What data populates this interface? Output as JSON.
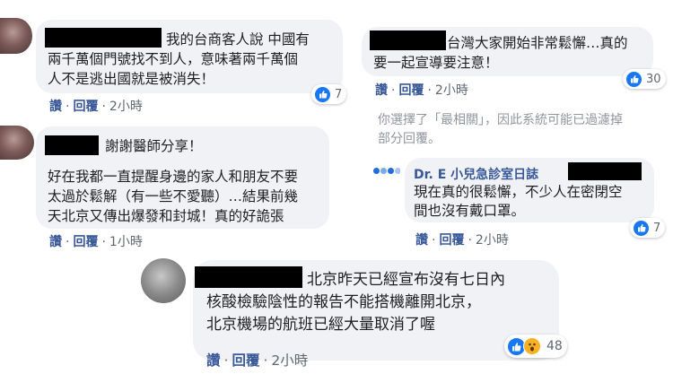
{
  "actions": {
    "like": "讚",
    "reply": "回覆",
    "sep": "·"
  },
  "comments": [
    {
      "lines": [
        "我的台商客人說 中國有",
        "兩千萬個門號找不到人，意味著兩千萬個",
        "人不是逃出國就是被消失！"
      ],
      "time": "2小時",
      "reactions": "7"
    },
    {
      "lines": [
        "謝謝醫師分享！",
        "好在我都一直提醒身邊的家人和朋友不要",
        "太過於鬆解（有一些不愛聽）…結果前幾",
        "天北京又傳出爆發和封城！真的好詭張"
      ],
      "time": "1小時"
    },
    {
      "lines": [
        "台灣大家開始非常鬆懈…真的",
        "要一起宣導要注意！"
      ],
      "time": "2小時",
      "reactions": "30"
    },
    {
      "notice": [
        "你選擇了「最相關」，因此系統可能已過濾掉",
        "部分回覆。"
      ]
    },
    {
      "author": "Dr. E 小兒急診室日誌",
      "lines": [
        "現在真的很鬆懈，不少人在密閉空",
        "間也沒有戴口罩。"
      ],
      "time": "2小時",
      "reactions": "7"
    },
    {
      "lines": [
        "北京昨天已經宣布沒有七日內",
        "核酸檢驗陰性的報告不能搭機離開北京，",
        "北京機場的航班已經大量取消了喔"
      ],
      "time": "2小時",
      "reactions": "48"
    }
  ],
  "colors": {
    "link": "#385898",
    "bubble": "#f0f2f5",
    "like": "#1877f2",
    "wow": "#f7b125"
  }
}
